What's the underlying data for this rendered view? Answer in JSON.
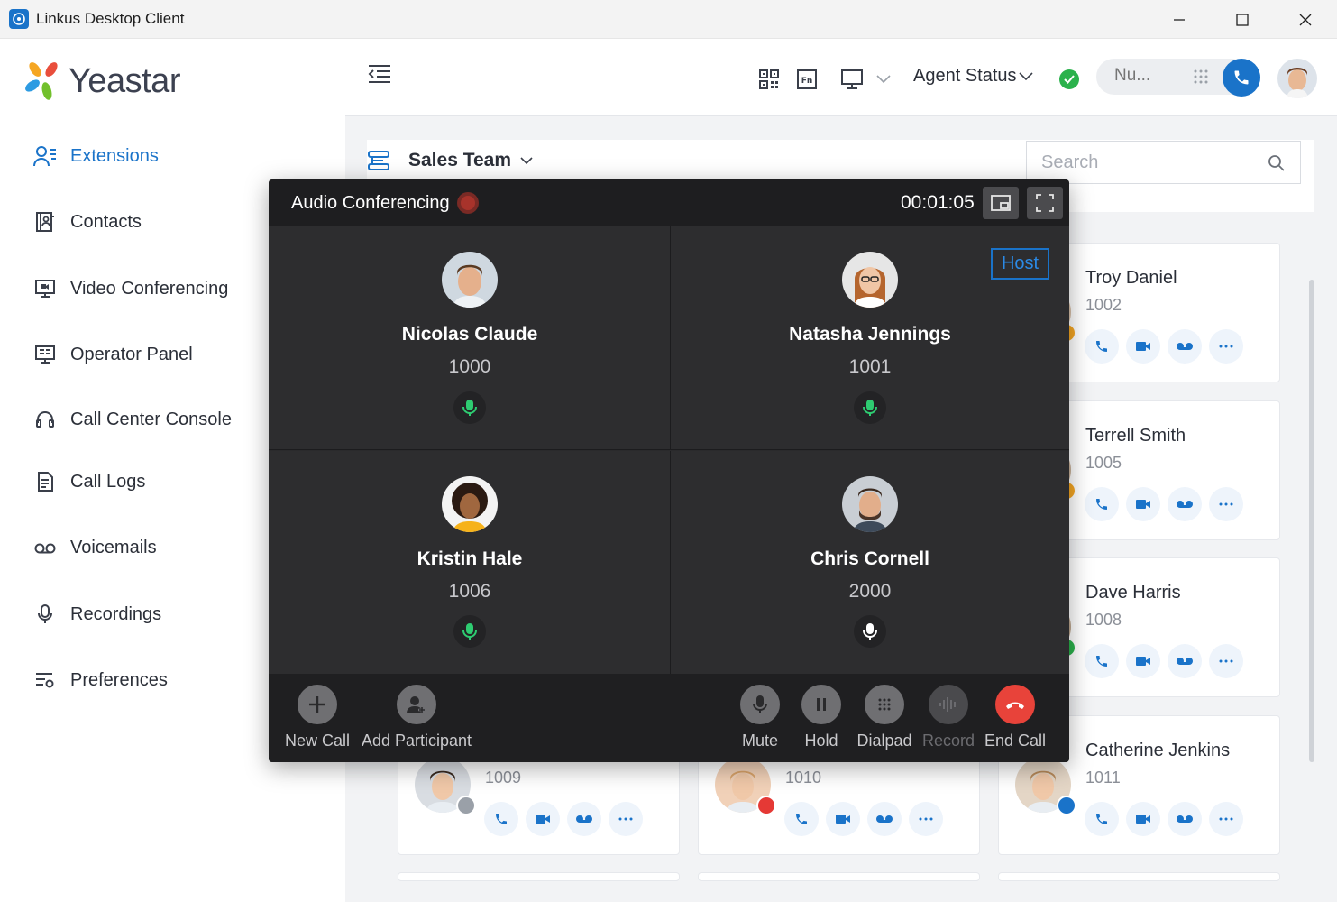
{
  "window": {
    "title": "Linkus Desktop Client"
  },
  "brand": {
    "name": "Yeastar"
  },
  "sidebar": {
    "items": [
      {
        "label": "Extensions",
        "icon": "extensions-icon",
        "active": true
      },
      {
        "label": "Contacts",
        "icon": "contacts-icon"
      },
      {
        "label": "Video Conferencing",
        "icon": "video-conferencing-icon"
      },
      {
        "label": "Operator Panel",
        "icon": "operator-panel-icon"
      },
      {
        "label": "Call Center Console",
        "icon": "headset-icon"
      },
      {
        "label": "Call Logs",
        "icon": "call-logs-icon"
      },
      {
        "label": "Voicemails",
        "icon": "voicemail-icon"
      },
      {
        "label": "Recordings",
        "icon": "microphone-icon"
      },
      {
        "label": "Preferences",
        "icon": "preferences-icon"
      }
    ]
  },
  "topbar": {
    "agent_status_label": "Agent Status",
    "dial_placeholder": "Nu..."
  },
  "main": {
    "group": "Sales Team",
    "search_placeholder": "Search"
  },
  "cards": [
    {
      "name": "Troy Daniel",
      "ext": "1002"
    },
    {
      "name": "Terrell Smith",
      "ext": "1005"
    },
    {
      "name": "Dave Harris",
      "ext": "1008"
    },
    {
      "name": "",
      "ext": "1009"
    },
    {
      "name": "",
      "ext": "1010"
    },
    {
      "name": "Catherine Jenkins",
      "ext": "1011"
    }
  ],
  "conference": {
    "title": "Audio Conferencing",
    "timer": "00:01:05",
    "host_label": "Host",
    "participants": [
      {
        "name": "Nicolas Claude",
        "ext": "1000",
        "mic": "active"
      },
      {
        "name": "Natasha Jennings",
        "ext": "1001",
        "mic": "active",
        "host": true
      },
      {
        "name": "Kristin Hale",
        "ext": "1006",
        "mic": "active"
      },
      {
        "name": "Chris Cornell",
        "ext": "2000",
        "mic": "idle"
      }
    ],
    "controls": {
      "new_call": "New Call",
      "add_participant": "Add Participant",
      "mute": "Mute",
      "hold": "Hold",
      "dialpad": "Dialpad",
      "record": "Record",
      "end_call": "End Call"
    }
  },
  "colors": {
    "accent": "#1a73c9",
    "mic_active": "#2ecc71",
    "end_call": "#e8433a",
    "status_online": "#2bb24c",
    "status_busy": "#e53935",
    "status_away": "#f5a623"
  }
}
